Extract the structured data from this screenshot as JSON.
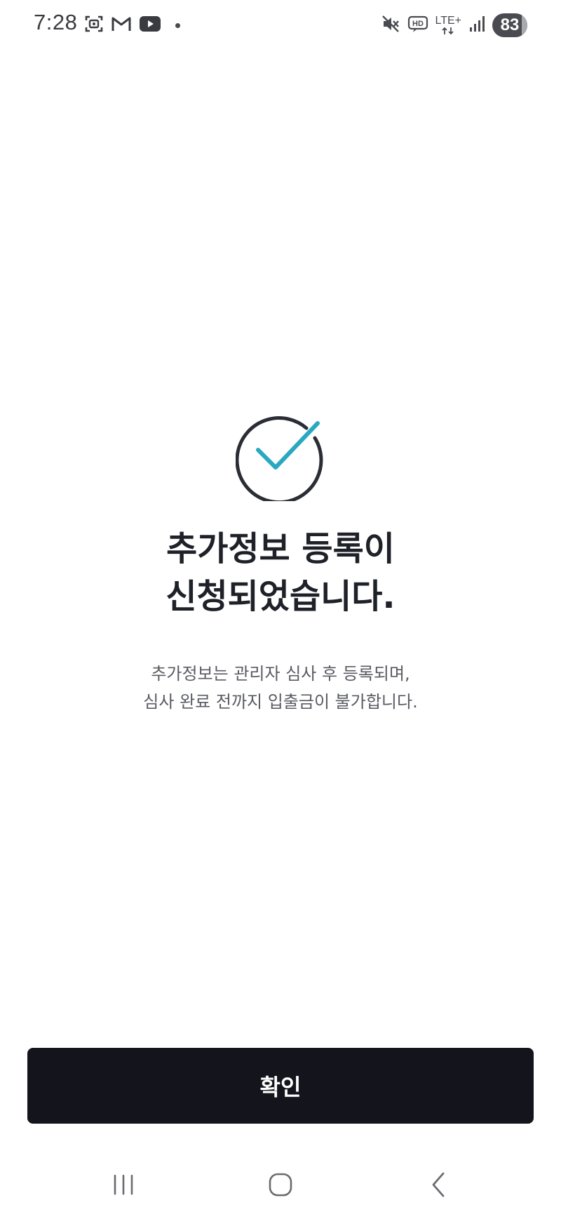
{
  "status_bar": {
    "time": "7:28",
    "left_icons": [
      "screenshot-icon",
      "gmail-icon",
      "youtube-icon",
      "notification-dot-icon"
    ],
    "right_icons": [
      "mute-icon",
      "hd-icon",
      "lte-icon",
      "signal-icon",
      "battery-icon"
    ],
    "lte_label": "LTE+",
    "hd_label": "HD",
    "battery_level": "83"
  },
  "result": {
    "icon": "check-circle-icon",
    "title_line1": "추가정보 등록이",
    "title_line2": "신청되었습니다.",
    "desc_line1": "추가정보는 관리자 심사 후 등록되며,",
    "desc_line2": "심사 완료 전까지 입출금이 불가합니다."
  },
  "actions": {
    "confirm_label": "확인"
  },
  "nav_bar": {
    "items": [
      "recent-apps-icon",
      "home-icon",
      "back-icon"
    ]
  },
  "colors": {
    "accent": "#2aa8c2",
    "ring": "#2b2d35",
    "button_bg": "#14151c",
    "title": "#1f2129",
    "description": "#5a5c63"
  }
}
